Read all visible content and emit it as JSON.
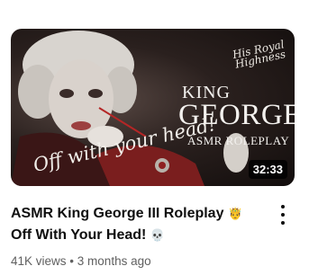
{
  "video": {
    "thumbnail": {
      "overlay_king": "KING",
      "overlay_george": "GEORGE III",
      "overlay_asmr": "ASMR ROLEPLAY",
      "overlay_royal": "His Royal Highness",
      "overlay_off": "Off with your head!",
      "duration": "32:33"
    },
    "title_line1": "ASMR King George III Roleplay",
    "title_emoji1": "🤴",
    "title_line2": "Off With Your Head!",
    "title_emoji2": "💀",
    "views": "41K views",
    "separator": "•",
    "age": "3 months ago",
    "more_icon": "more-vert-icon"
  }
}
